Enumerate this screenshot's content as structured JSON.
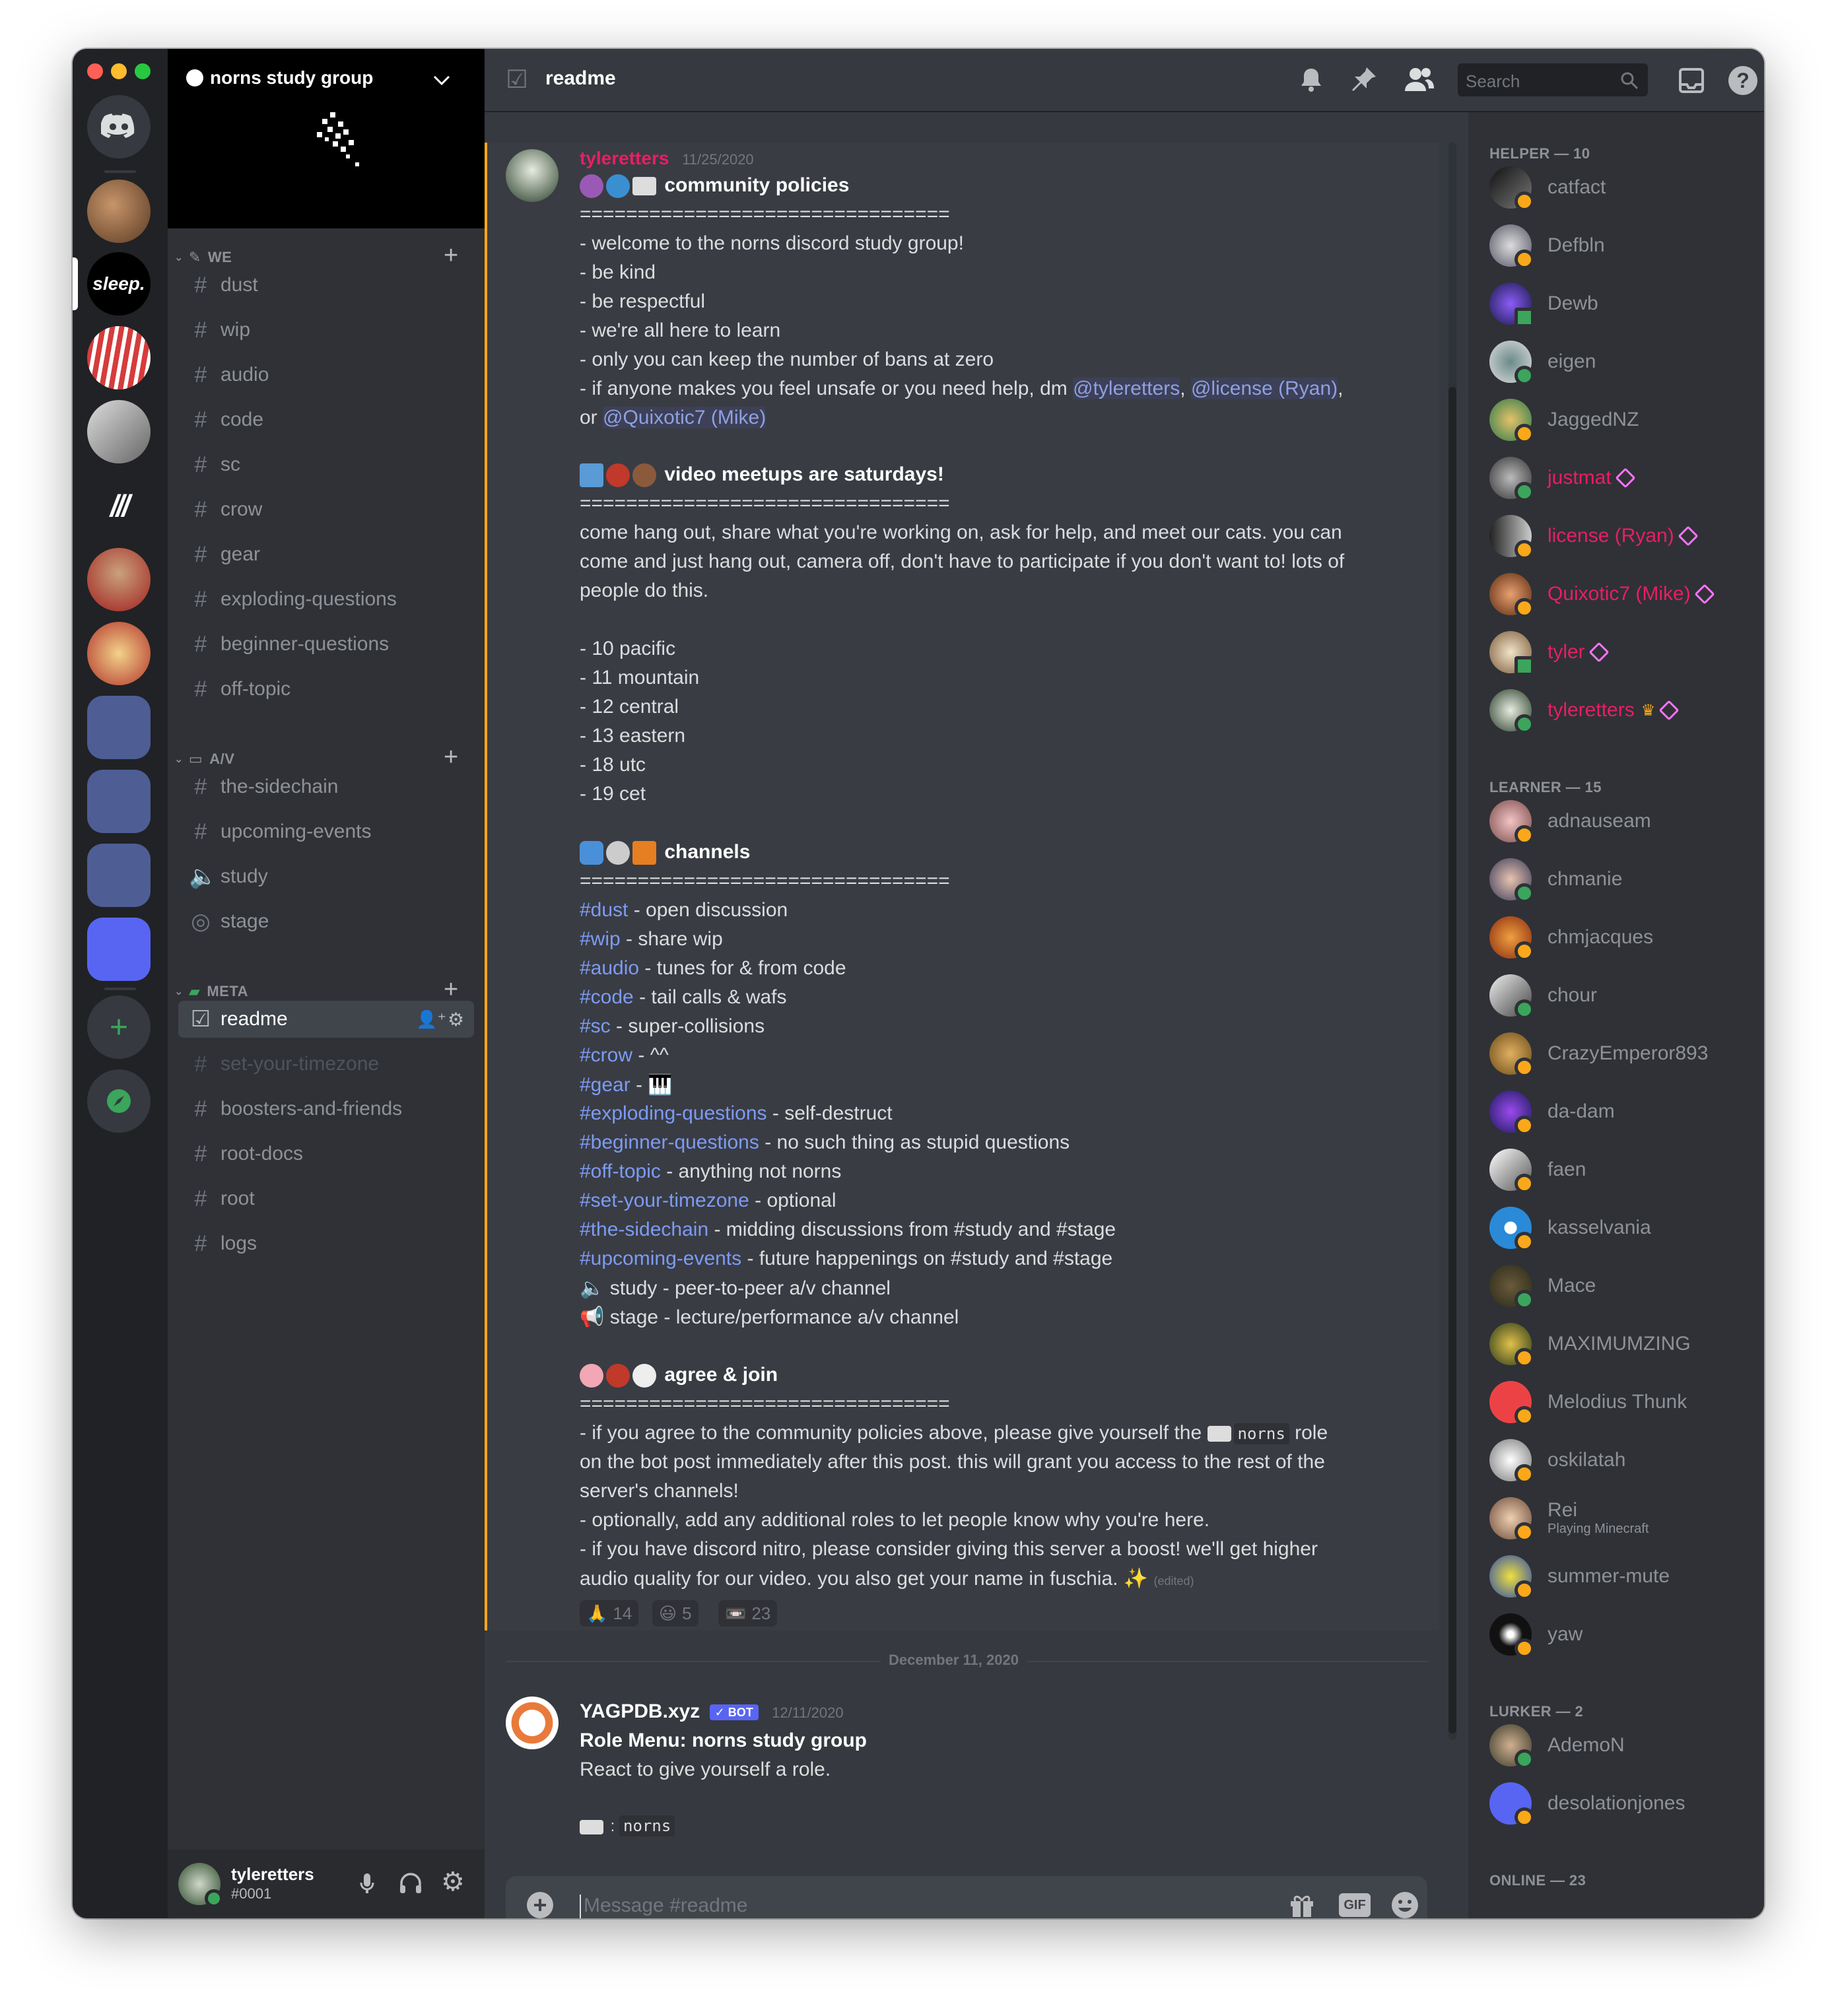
{
  "colors": {
    "blurple": "#5865f2",
    "green": "#3ba55c",
    "pink": "#e91e63",
    "link": "#7d9bf4",
    "highlight": "#faa81a"
  },
  "server": {
    "name": "norns study group"
  },
  "rail": {
    "add_icon": "plus-icon",
    "explore_icon": "compass-icon",
    "sleep_label": "sleep.",
    "home_icon": "discord-logo-icon"
  },
  "categories": [
    {
      "name": "WE",
      "channels": [
        {
          "label": "dust"
        },
        {
          "label": "wip"
        },
        {
          "label": "audio"
        },
        {
          "label": "code"
        },
        {
          "label": "sc"
        },
        {
          "label": "crow"
        },
        {
          "label": "gear"
        },
        {
          "label": "exploding-questions"
        },
        {
          "label": "beginner-questions"
        },
        {
          "label": "off-topic"
        }
      ]
    },
    {
      "name": "A/V",
      "channels": [
        {
          "label": "the-sidechain"
        },
        {
          "label": "upcoming-events"
        },
        {
          "label": "study"
        },
        {
          "label": "stage"
        }
      ]
    },
    {
      "name": "META",
      "channels": [
        {
          "label": "readme"
        },
        {
          "label": "set-your-timezone"
        },
        {
          "label": "boosters-and-friends"
        },
        {
          "label": "root-docs"
        },
        {
          "label": "root"
        },
        {
          "label": "logs"
        }
      ]
    }
  ],
  "user": {
    "name": "tyleretters",
    "tag": "#0001"
  },
  "header": {
    "channel": "readme",
    "search_placeholder": "Search"
  },
  "message1": {
    "author": "tyleretters",
    "timestamp": "11/25/2020",
    "lines": [
      {
        "t": "community policies",
        "bold": true
      },
      {
        "t": "================================"
      },
      {
        "t": " - welcome to the norns discord study group!"
      },
      {
        "t": " - be kind"
      },
      {
        "t": " - be respectful"
      },
      {
        "t": " - we're all here to learn"
      },
      {
        "t": " - only you can keep the number of bans at zero"
      },
      {
        "t": " - if anyone makes you feel unsafe or you need help, dm "
      },
      {
        "t": "or "
      },
      {
        "t": "video meetups are saturdays!",
        "bold": true
      },
      {
        "t": "================================"
      },
      {
        "t": "come hang out, share what you're working on, ask for help, and meet our cats. you can"
      },
      {
        "t": "come and just hang out, camera off, don't have to participate if you don't want to! lots of"
      },
      {
        "t": "people do this."
      },
      {
        "t": " - 10 pacific"
      },
      {
        "t": " - 11 mountain"
      },
      {
        "t": " - 12 central"
      },
      {
        "t": " - 13 eastern"
      },
      {
        "t": " - 18 utc"
      },
      {
        "t": " - 19 cet"
      },
      {
        "t": "channels",
        "bold": true
      },
      {
        "t": "================================"
      }
    ],
    "mentions": [
      "@tyleretters",
      "@license (Ryan)",
      "@Quixotic7 (Mike)"
    ],
    "channel_list": [
      {
        "link": "#dust",
        "desc": " - open discussion"
      },
      {
        "link": "#wip",
        "desc": " - share wip"
      },
      {
        "link": "#audio",
        "desc": " - tunes for & from code"
      },
      {
        "link": "#code",
        "desc": " - tail calls & wafs"
      },
      {
        "link": "#sc",
        "desc": " - super-collisions"
      },
      {
        "link": "#crow",
        "desc": " - ^^"
      },
      {
        "link": "#gear",
        "desc": " - 🎹"
      },
      {
        "link": "#exploding-questions",
        "desc": " - self-destruct"
      },
      {
        "link": "#beginner-questions",
        "desc": " - no such thing as stupid questions"
      },
      {
        "link": "#off-topic",
        "desc": " - anything not norns"
      },
      {
        "link": "#set-your-timezone",
        "desc": " - optional"
      },
      {
        "link": "#the-sidechain",
        "desc": " -  midding discussions from #study and #stage"
      },
      {
        "link": "#upcoming-events",
        "desc": " - future happenings on #study and #stage"
      },
      {
        "link": "",
        "desc": "🔈 study - peer-to-peer a/v channel"
      },
      {
        "link": "",
        "desc": "📢 stage - lecture/performance a/v channel"
      }
    ],
    "agree_title": "agree & join",
    "agree_rule": "================================",
    "agree_lines": [
      "- if you agree to the community policies above, please give yourself the ",
      "on the bot post immediately after this post. this will grant you access to the rest of the",
      "server's channels!",
      "- optionally, add any additional roles to let people know why you're here.",
      "- if you have discord nitro, please consider giving this server a boost! we'll get higher",
      "audio quality for our video. you also get your name in fuschia. ✨"
    ],
    "role_code": "norns",
    "role_suffix": " role",
    "edited": "(edited)",
    "reactions": [
      {
        "emoji": "🙏",
        "count": "14"
      },
      {
        "emoji": "😃",
        "count": "5"
      },
      {
        "emoji": "📼",
        "count": "23"
      }
    ]
  },
  "divider": {
    "date": "December 11, 2020"
  },
  "message2": {
    "author": "YAGPDB.xyz",
    "bot_tag": "✓ BOT",
    "timestamp": "12/11/2020",
    "title": "Role Menu: norns study group",
    "body": "React to give yourself a role.",
    "role": "norns"
  },
  "composer": {
    "placeholder": "Message #readme",
    "gif": "GIF"
  },
  "members": {
    "groups": [
      {
        "label": "HELPER — 10",
        "items": [
          {
            "name": "catfact",
            "pink": false
          },
          {
            "name": "Defbln",
            "pink": false
          },
          {
            "name": "Dewb",
            "pink": false
          },
          {
            "name": "eigen",
            "pink": false
          },
          {
            "name": "JaggedNZ",
            "pink": false
          },
          {
            "name": "justmat",
            "pink": true
          },
          {
            "name": "license (Ryan)",
            "pink": true
          },
          {
            "name": "Quixotic7 (Mike)",
            "pink": true
          },
          {
            "name": "tyler",
            "pink": true
          },
          {
            "name": "tyleretters",
            "pink": true
          }
        ]
      },
      {
        "label": "LEARNER — 15",
        "items": [
          {
            "name": "adnauseam"
          },
          {
            "name": "chmanie"
          },
          {
            "name": "chmjacques"
          },
          {
            "name": "chour"
          },
          {
            "name": "CrazyEmperor893"
          },
          {
            "name": "da-dam"
          },
          {
            "name": "faen"
          },
          {
            "name": "kasselvania"
          },
          {
            "name": "Mace"
          },
          {
            "name": "MAXIMUMZING"
          },
          {
            "name": "Melodius Thunk"
          },
          {
            "name": "oskilatah"
          },
          {
            "name": "Rei",
            "activity": "Playing Minecraft"
          },
          {
            "name": "summer-mute"
          },
          {
            "name": "yaw"
          }
        ]
      },
      {
        "label": "LURKER — 2",
        "items": [
          {
            "name": "AdemoN"
          },
          {
            "name": "desolationjones"
          }
        ]
      },
      {
        "label": "ONLINE — 23",
        "items": []
      }
    ]
  }
}
